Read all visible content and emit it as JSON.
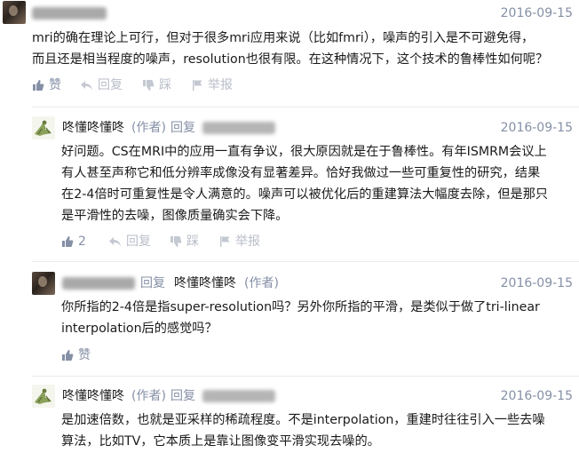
{
  "comments": [
    {
      "author": "",
      "date": "2016-09-15",
      "lines": [
        "mri的确在理论上可行，但对于很多mri应用来说（比如fmri），噪声的引入是不可避免得，",
        "而且还是相当程度的噪声，resolution也很有限。在这种情况下，这个技术的鲁棒性如何呢？"
      ],
      "actions": {
        "like": "赞",
        "reply": "回复",
        "dislike": "踩",
        "report": "举报"
      }
    },
    {
      "author": "咚懂咚懂咚",
      "badge": "(作者)",
      "reply_word": "回复",
      "date": "2016-09-15",
      "lines": [
        "好问题。CS在MRI中的应用一直有争议，很大原因就是在于鲁棒性。有年ISMRM会议上",
        "有人甚至声称它和低分辨率成像没有显著差异。恰好我做过一些可重复性的研究，结果",
        "在2-4倍时可重复性是令人满意的。噪声可以被优化后的重建算法大幅度去除，但是那只",
        "是平滑性的去噪，图像质量确实会下降。"
      ],
      "actions": {
        "like": "2",
        "reply": "回复",
        "dislike": "踩",
        "report": "举报"
      }
    },
    {
      "reply_word": "回复",
      "reply_to": "咚懂咚懂咚",
      "reply_to_badge": "(作者)",
      "date": "2016-09-15",
      "lines": [
        "你所指的2-4倍是指super-resolution吗？另外你所指的平滑，是类似于做了tri-linear",
        "interpolation后的感觉吗？"
      ],
      "actions": {
        "like": "赞"
      }
    },
    {
      "author": "咚懂咚懂咚",
      "badge": "(作者)",
      "reply_word": "回复",
      "date": "2016-09-15",
      "lines": [
        "是加速倍数，也就是亚采样的稀疏程度。不是interpolation，重建时往往引入一些去噪",
        "算法，比如TV，它本质上是靠让图像变平滑实现去噪的。"
      ]
    }
  ],
  "colors": {
    "meta": "#8590a6",
    "text": "#1a1a1a",
    "muted": "#b9bec9",
    "divider": "#ebebeb"
  },
  "icons": {
    "like": "thumbs-up-icon",
    "reply": "reply-arrow-icon",
    "dislike": "thumbs-down-icon",
    "report": "flag-icon"
  }
}
